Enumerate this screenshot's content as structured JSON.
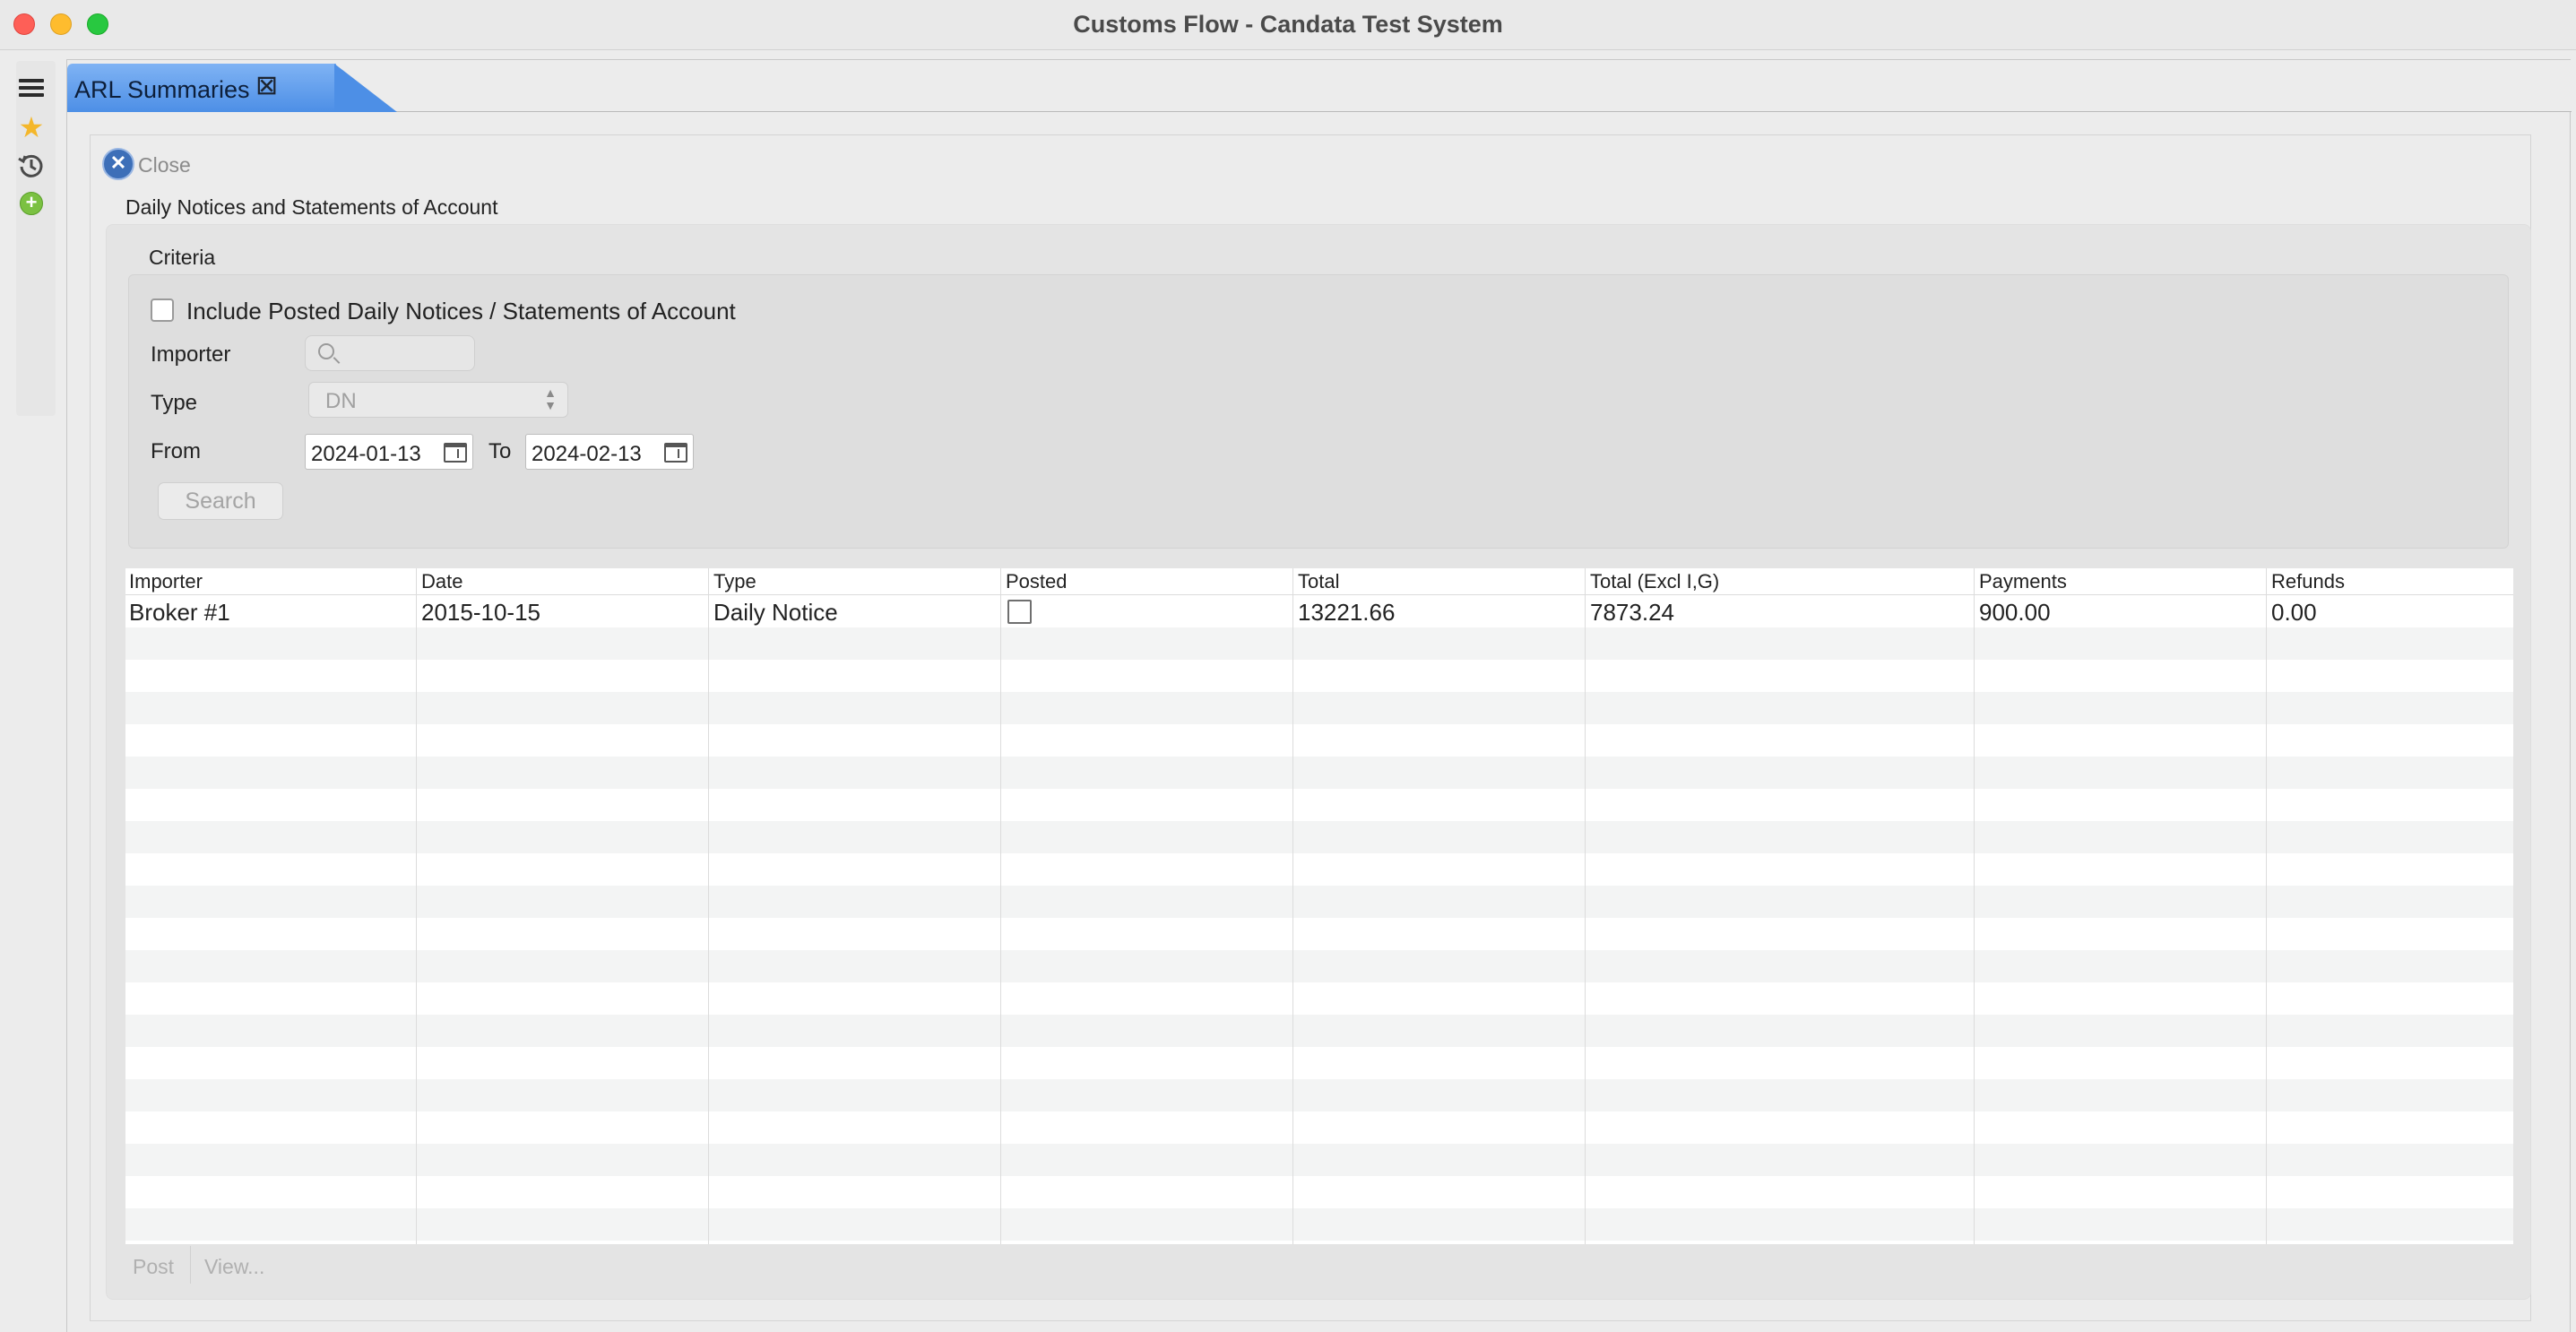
{
  "window": {
    "title": "Customs Flow - Candata Test System"
  },
  "tab": {
    "label": "ARL Summaries"
  },
  "close_label": "Close",
  "section_title": "Daily Notices and Statements of Account",
  "criteria": {
    "title": "Criteria",
    "include_posted_label": "Include Posted Daily Notices / Statements of Account",
    "importer_label": "Importer",
    "importer_value": "",
    "type_label": "Type",
    "type_value": "DN",
    "from_label": "From",
    "from_value": "2024-01-13",
    "to_label": "To",
    "to_value": "2024-02-13",
    "search_label": "Search"
  },
  "table": {
    "columns": [
      "Importer",
      "Date",
      "Type",
      "Posted",
      "Total",
      "Total (Excl I,G)",
      "Payments",
      "Refunds"
    ],
    "rows": [
      {
        "importer": "Broker #1",
        "date": "2015-10-15",
        "type": "Daily Notice",
        "posted": false,
        "total": "13221.66",
        "total_excl": "7873.24",
        "payments": "900.00",
        "refunds": "0.00"
      }
    ]
  },
  "footer": {
    "post_label": "Post",
    "view_label": "View..."
  },
  "colors": {
    "tab_accent": "#4d8fe6",
    "close_button": "#3d6fb8",
    "add_icon": "#7bc142",
    "star_icon": "#f4b72b"
  }
}
